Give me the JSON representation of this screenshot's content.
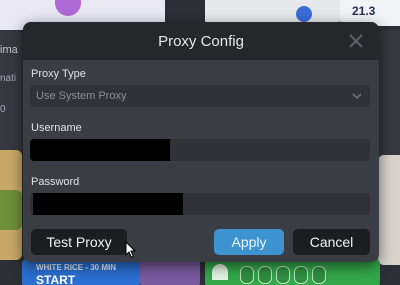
{
  "background": {
    "chart_number": "21.3",
    "left_text_1": "ima",
    "left_text_2": "nati",
    "left_text_3": "0",
    "bottom_tile_subtitle": "WHITE RICE - 30 MIN",
    "bottom_tile_title": "START"
  },
  "dialog": {
    "title": "Proxy Config",
    "proxy_type_label": "Proxy Type",
    "proxy_type_value": "Use System Proxy",
    "username_label": "Username",
    "password_label": "Password",
    "test_button": "Test Proxy",
    "apply_button": "Apply",
    "cancel_button": "Cancel"
  },
  "colors": {
    "accent": "#3d93cf",
    "dialog_bg": "#3a3d44",
    "header_bg": "#25272b"
  },
  "icons": {
    "close": "close-icon",
    "dropdown": "chevron-down-icon",
    "cursor": "mouse-pointer-icon"
  }
}
